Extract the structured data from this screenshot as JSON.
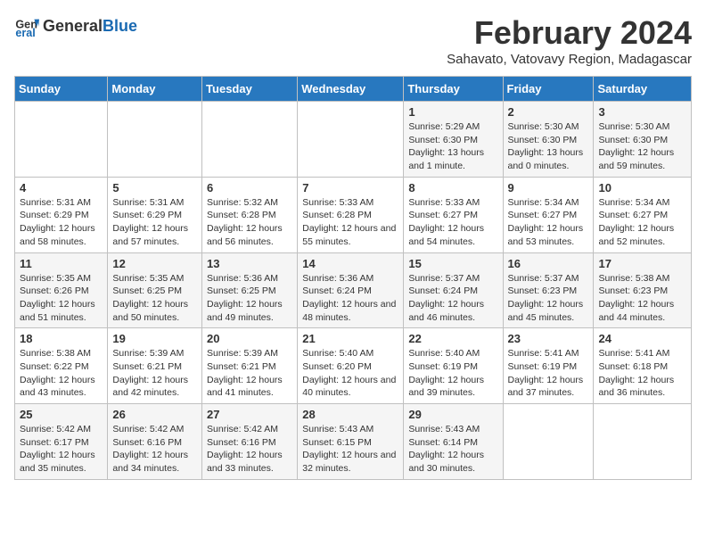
{
  "header": {
    "logo_general": "General",
    "logo_blue": "Blue",
    "title": "February 2024",
    "subtitle": "Sahavato, Vatovavy Region, Madagascar"
  },
  "calendar": {
    "days_of_week": [
      "Sunday",
      "Monday",
      "Tuesday",
      "Wednesday",
      "Thursday",
      "Friday",
      "Saturday"
    ],
    "weeks": [
      [
        {
          "day": "",
          "info": ""
        },
        {
          "day": "",
          "info": ""
        },
        {
          "day": "",
          "info": ""
        },
        {
          "day": "",
          "info": ""
        },
        {
          "day": "1",
          "info": "Sunrise: 5:29 AM\nSunset: 6:30 PM\nDaylight: 13 hours and 1 minute."
        },
        {
          "day": "2",
          "info": "Sunrise: 5:30 AM\nSunset: 6:30 PM\nDaylight: 13 hours and 0 minutes."
        },
        {
          "day": "3",
          "info": "Sunrise: 5:30 AM\nSunset: 6:30 PM\nDaylight: 12 hours and 59 minutes."
        }
      ],
      [
        {
          "day": "4",
          "info": "Sunrise: 5:31 AM\nSunset: 6:29 PM\nDaylight: 12 hours and 58 minutes."
        },
        {
          "day": "5",
          "info": "Sunrise: 5:31 AM\nSunset: 6:29 PM\nDaylight: 12 hours and 57 minutes."
        },
        {
          "day": "6",
          "info": "Sunrise: 5:32 AM\nSunset: 6:28 PM\nDaylight: 12 hours and 56 minutes."
        },
        {
          "day": "7",
          "info": "Sunrise: 5:33 AM\nSunset: 6:28 PM\nDaylight: 12 hours and 55 minutes."
        },
        {
          "day": "8",
          "info": "Sunrise: 5:33 AM\nSunset: 6:27 PM\nDaylight: 12 hours and 54 minutes."
        },
        {
          "day": "9",
          "info": "Sunrise: 5:34 AM\nSunset: 6:27 PM\nDaylight: 12 hours and 53 minutes."
        },
        {
          "day": "10",
          "info": "Sunrise: 5:34 AM\nSunset: 6:27 PM\nDaylight: 12 hours and 52 minutes."
        }
      ],
      [
        {
          "day": "11",
          "info": "Sunrise: 5:35 AM\nSunset: 6:26 PM\nDaylight: 12 hours and 51 minutes."
        },
        {
          "day": "12",
          "info": "Sunrise: 5:35 AM\nSunset: 6:25 PM\nDaylight: 12 hours and 50 minutes."
        },
        {
          "day": "13",
          "info": "Sunrise: 5:36 AM\nSunset: 6:25 PM\nDaylight: 12 hours and 49 minutes."
        },
        {
          "day": "14",
          "info": "Sunrise: 5:36 AM\nSunset: 6:24 PM\nDaylight: 12 hours and 48 minutes."
        },
        {
          "day": "15",
          "info": "Sunrise: 5:37 AM\nSunset: 6:24 PM\nDaylight: 12 hours and 46 minutes."
        },
        {
          "day": "16",
          "info": "Sunrise: 5:37 AM\nSunset: 6:23 PM\nDaylight: 12 hours and 45 minutes."
        },
        {
          "day": "17",
          "info": "Sunrise: 5:38 AM\nSunset: 6:23 PM\nDaylight: 12 hours and 44 minutes."
        }
      ],
      [
        {
          "day": "18",
          "info": "Sunrise: 5:38 AM\nSunset: 6:22 PM\nDaylight: 12 hours and 43 minutes."
        },
        {
          "day": "19",
          "info": "Sunrise: 5:39 AM\nSunset: 6:21 PM\nDaylight: 12 hours and 42 minutes."
        },
        {
          "day": "20",
          "info": "Sunrise: 5:39 AM\nSunset: 6:21 PM\nDaylight: 12 hours and 41 minutes."
        },
        {
          "day": "21",
          "info": "Sunrise: 5:40 AM\nSunset: 6:20 PM\nDaylight: 12 hours and 40 minutes."
        },
        {
          "day": "22",
          "info": "Sunrise: 5:40 AM\nSunset: 6:19 PM\nDaylight: 12 hours and 39 minutes."
        },
        {
          "day": "23",
          "info": "Sunrise: 5:41 AM\nSunset: 6:19 PM\nDaylight: 12 hours and 37 minutes."
        },
        {
          "day": "24",
          "info": "Sunrise: 5:41 AM\nSunset: 6:18 PM\nDaylight: 12 hours and 36 minutes."
        }
      ],
      [
        {
          "day": "25",
          "info": "Sunrise: 5:42 AM\nSunset: 6:17 PM\nDaylight: 12 hours and 35 minutes."
        },
        {
          "day": "26",
          "info": "Sunrise: 5:42 AM\nSunset: 6:16 PM\nDaylight: 12 hours and 34 minutes."
        },
        {
          "day": "27",
          "info": "Sunrise: 5:42 AM\nSunset: 6:16 PM\nDaylight: 12 hours and 33 minutes."
        },
        {
          "day": "28",
          "info": "Sunrise: 5:43 AM\nSunset: 6:15 PM\nDaylight: 12 hours and 32 minutes."
        },
        {
          "day": "29",
          "info": "Sunrise: 5:43 AM\nSunset: 6:14 PM\nDaylight: 12 hours and 30 minutes."
        },
        {
          "day": "",
          "info": ""
        },
        {
          "day": "",
          "info": ""
        }
      ]
    ]
  }
}
